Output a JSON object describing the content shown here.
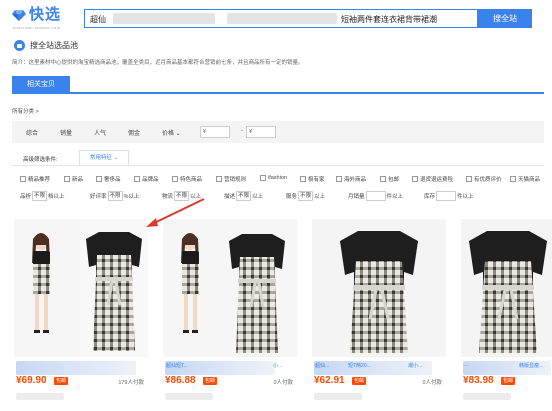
{
  "header": {
    "logo_text": "快选",
    "logo_sub": "kuaixuan.taobao.com",
    "search_value_start": "超仙",
    "search_value_end": "短袖两件套连衣裙背带裙潮",
    "search_button": "搜全站"
  },
  "pool": {
    "title": "搜全站选品池",
    "intro": "简介：这里素材中心提供的淘宝精选商品池，覆盖全类目，近月商品基本都符合营销前七条，并且商品所有一定的销量。"
  },
  "tab": {
    "label": "相关宝贝"
  },
  "category": {
    "label": "所有分类 >"
  },
  "sort": {
    "items": [
      "综合",
      "销量",
      "人气",
      "佣金",
      "价格 ⌄"
    ],
    "price_from": "¥",
    "price_dash": "-",
    "price_to": "¥"
  },
  "filters": {
    "label": "高级筛选条件:",
    "tab": "常用特征 ⌄",
    "checks": [
      "精品推荐",
      "新品",
      "奢侈品",
      "品牌品",
      "特色商品",
      "营销规则",
      "ifashion",
      "极有家",
      "海外商品",
      "包邮",
      "退货退运费险",
      "有优质评价",
      "天猫商品"
    ],
    "ranges": [
      {
        "pre": "品析",
        "val": "不限",
        "post": "档以上"
      },
      {
        "pre": "好评率",
        "val": "不限",
        "post": "%以上"
      },
      {
        "pre": "物流",
        "val": "不限",
        "post": "以上"
      },
      {
        "pre": "描述",
        "val": "不限",
        "post": "以上"
      },
      {
        "pre": "服务",
        "val": "不限",
        "post": "以上"
      },
      {
        "pre": "月销量",
        "val": "",
        "post": "件以上"
      },
      {
        "pre": "库存",
        "val": "",
        "post": "件以上"
      }
    ]
  },
  "products": [
    {
      "title": "",
      "price": "¥69.90",
      "tag": "包邮",
      "sales": "179人付款"
    },
    {
      "title": "超仙短T...",
      "title_end": "小...",
      "price": "¥86.88",
      "tag": "包邮",
      "sales": "0人付款"
    },
    {
      "title": "超仙...",
      "title_mid": "短T两20...",
      "title_end": "潮小...",
      "price": "¥62.91",
      "tag": "包邮",
      "sales": "0人付款"
    },
    {
      "title": "...",
      "title_end": "韩版显瘦...",
      "price": "¥83.98",
      "tag": "包邮",
      "sales": ""
    }
  ],
  "colors": {
    "accent": "#3a82ec",
    "price": "#ff4a00",
    "arrow": "#e0392b"
  }
}
